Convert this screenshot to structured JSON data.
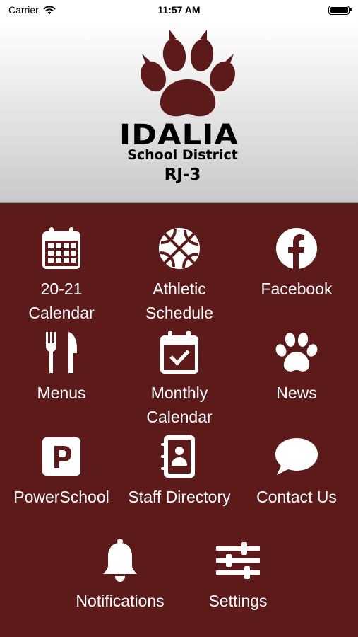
{
  "status_bar": {
    "carrier": "Carrier",
    "time": "11:57 AM",
    "wifi_icon": "wifi-icon",
    "battery_icon": "battery-icon"
  },
  "header": {
    "logo_icon": "paw-logo",
    "name": "IDALIA",
    "subtitle": "School District",
    "code": "RJ-3"
  },
  "colors": {
    "background": "#5c1a1b",
    "logo": "#5c1a1b",
    "text": "#ffffff"
  },
  "tiles": [
    {
      "label": "20-21\nCalendar",
      "icon": "calendar-grid-icon"
    },
    {
      "label": "Athletic\nSchedule",
      "icon": "basketball-icon"
    },
    {
      "label": "Facebook",
      "icon": "facebook-icon"
    },
    {
      "label": "Menus",
      "icon": "fork-knife-icon"
    },
    {
      "label": "Monthly\nCalendar",
      "icon": "calendar-check-icon"
    },
    {
      "label": "News",
      "icon": "paw-icon"
    },
    {
      "label": "PowerSchool",
      "icon": "powerschool-icon"
    },
    {
      "label": "Staff Directory",
      "icon": "contact-book-icon"
    },
    {
      "label": "Contact Us",
      "icon": "chat-bubble-icon"
    },
    {
      "label": "Notifications",
      "icon": "bell-icon"
    },
    {
      "label": "Settings",
      "icon": "sliders-icon"
    }
  ]
}
